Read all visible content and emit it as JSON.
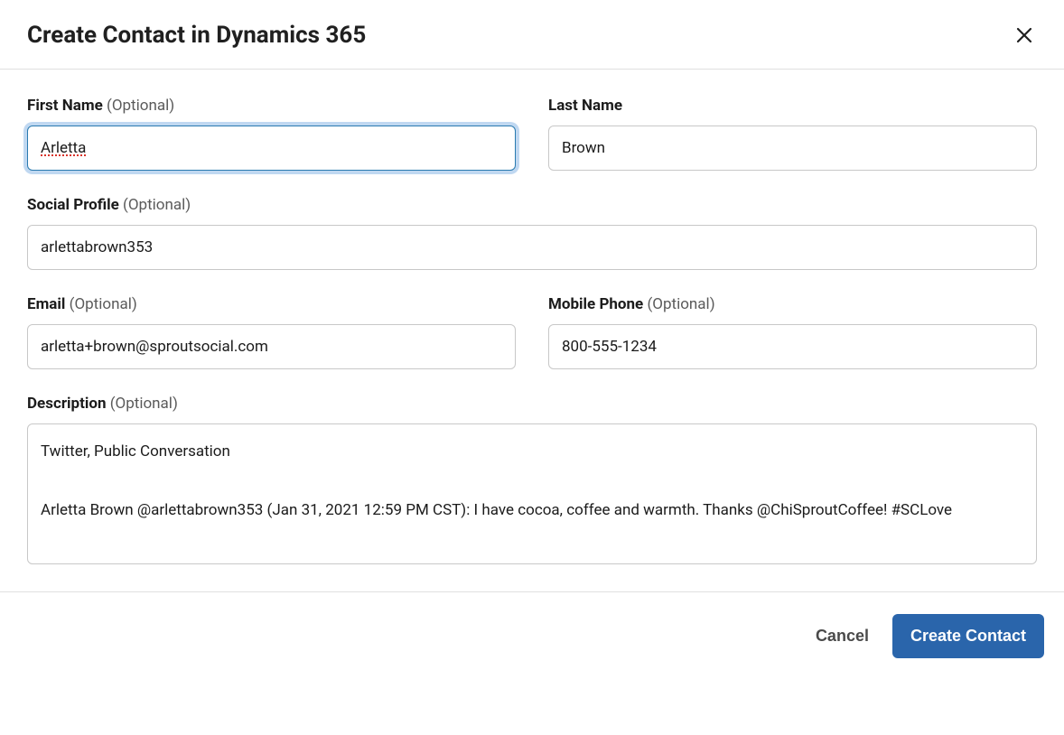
{
  "header": {
    "title": "Create Contact in Dynamics 365"
  },
  "labels": {
    "optional_suffix": "(Optional)"
  },
  "fields": {
    "first_name": {
      "label": "First Name",
      "optional": true,
      "value": "Arletta",
      "focused": true
    },
    "last_name": {
      "label": "Last Name",
      "optional": false,
      "value": "Brown"
    },
    "social_profile": {
      "label": "Social Profile",
      "optional": true,
      "value": "arlettabrown353"
    },
    "email": {
      "label": "Email",
      "optional": true,
      "value": "arletta+brown@sproutsocial.com"
    },
    "mobile_phone": {
      "label": "Mobile Phone",
      "optional": true,
      "value": "800-555-1234"
    },
    "description": {
      "label": "Description",
      "optional": true,
      "value": "Twitter, Public Conversation\n\nArletta Brown @arlettabrown353 (Jan 31, 2021 12:59 PM CST): I have cocoa, coffee and warmth. Thanks @ChiSproutCoffee! #SCLove"
    }
  },
  "footer": {
    "cancel_label": "Cancel",
    "submit_label": "Create Contact"
  }
}
